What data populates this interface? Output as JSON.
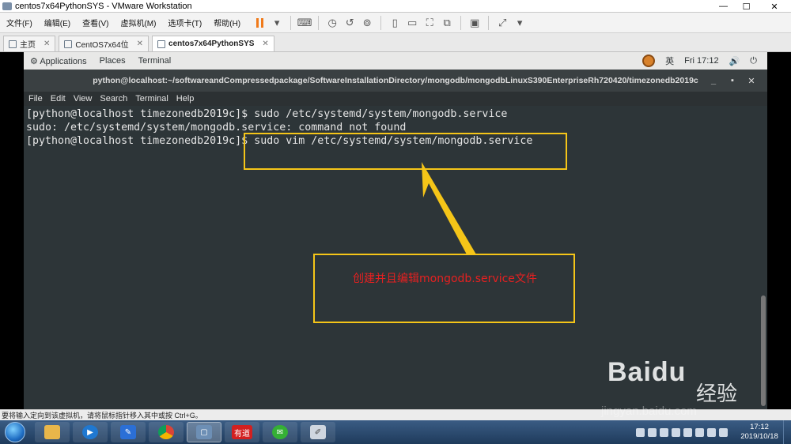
{
  "window": {
    "title": "centos7x64PythonSYS - VMware Workstation",
    "controls": {
      "minimize": "—",
      "maximize": "☐",
      "close": "✕"
    }
  },
  "vmware_menu": [
    "文件(F)",
    "编辑(E)",
    "查看(V)",
    "虚拟机(M)",
    "选项卡(T)",
    "帮助(H)"
  ],
  "vmware_tabs": [
    {
      "label": "主页",
      "active": false
    },
    {
      "label": "CentOS7x64位",
      "active": false
    },
    {
      "label": "centos7x64PythonSYS",
      "active": true
    }
  ],
  "gnome_topbar": {
    "applications": "Applications",
    "places": "Places",
    "terminal": "Terminal",
    "input_method": "英",
    "clock": "Fri 17:12",
    "volume_icon": "🔊",
    "power_icon": "⏻"
  },
  "terminal": {
    "title": "python@localhost:~/softwareandCompressedpackage/SoftwareInstallationDirectory/mongodb/mongodbLinuxS390EnterpriseRh720420/timezonedb2019c",
    "controls": {
      "minimize": "_",
      "maximize": "▪",
      "close": "✕"
    },
    "menu": [
      "File",
      "Edit",
      "View",
      "Search",
      "Terminal",
      "Help"
    ],
    "lines": [
      "[python@localhost timezonedb2019c]$ sudo /etc/systemd/system/mongodb.service",
      "sudo: /etc/systemd/system/mongodb.service: command not found",
      "[python@localhost timezonedb2019c]$ sudo vim /etc/systemd/system/mongodb.service"
    ]
  },
  "annotation": {
    "text": "创建并且编辑mongodb.service文件",
    "color": "#e62020",
    "box_color": "#f5c518"
  },
  "status_bar": {
    "text": "要将输入定向到该虚拟机，请将鼠标指针移入其中或按 Ctrl+G。"
  },
  "taskbar": {
    "apps": [
      "explorer",
      "media-player",
      "feather",
      "chrome",
      "vmware",
      "youdao",
      "wechat",
      "paint"
    ],
    "youdao_label": "有道",
    "clock_time": "17:12",
    "clock_date": "2019/10/18"
  },
  "watermark": {
    "brand": "Baidu",
    "sub": "经验",
    "url": "jingyan.baidu.com"
  }
}
